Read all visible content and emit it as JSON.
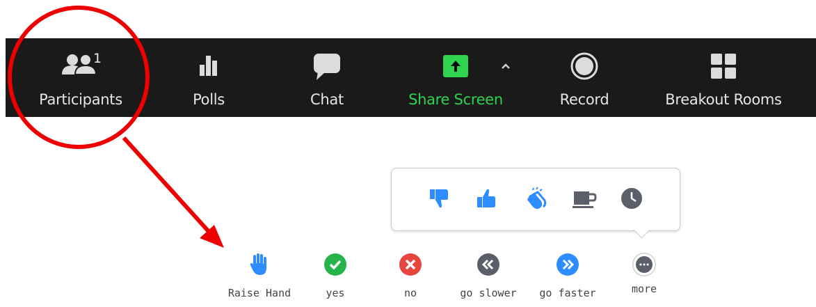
{
  "toolbar": {
    "participants": {
      "label": "Participants",
      "count": "1"
    },
    "polls": {
      "label": "Polls"
    },
    "chat": {
      "label": "Chat"
    },
    "share": {
      "label": "Share Screen"
    },
    "record": {
      "label": "Record"
    },
    "breakout": {
      "label": "Breakout Rooms"
    }
  },
  "reactions": [
    {
      "icon": "thumbs-down-icon"
    },
    {
      "icon": "thumbs-up-icon"
    },
    {
      "icon": "clapping-hands-icon"
    },
    {
      "icon": "coffee-cup-icon"
    },
    {
      "icon": "clock-icon"
    }
  ],
  "feedback": {
    "raise_hand": "Raise Hand",
    "yes": "yes",
    "no": "no",
    "slower": "go slower",
    "faster": "go faster",
    "more": "more"
  },
  "colors": {
    "toolbar_bg": "#1a1a1a",
    "share_green": "#2ed34e",
    "annotation_red": "#ee0000",
    "blue": "#2d8cff",
    "yes_green": "#25b34b",
    "no_red": "#e5463d",
    "gray": "#5a5f6a"
  }
}
